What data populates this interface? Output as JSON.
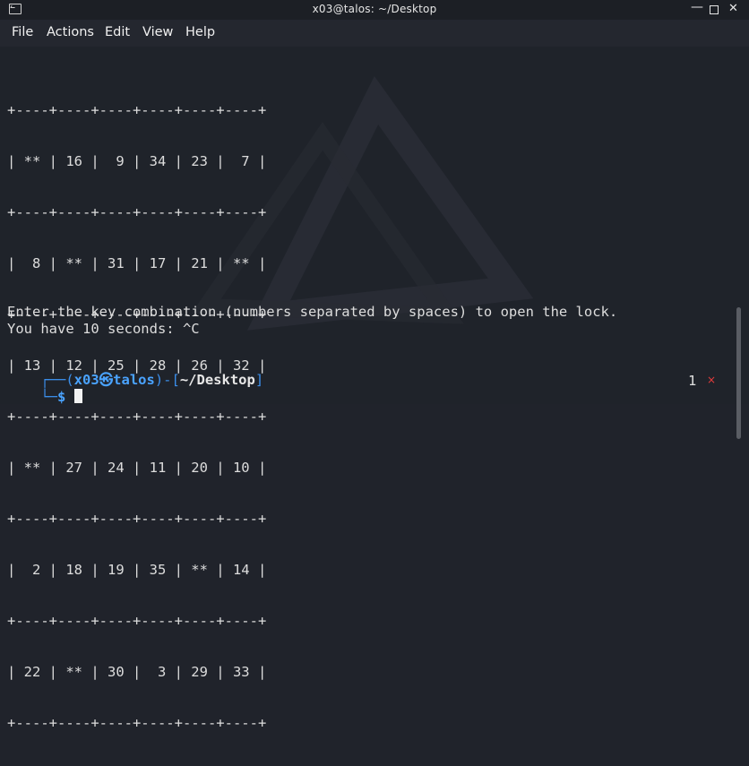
{
  "window": {
    "title": "x03@talos: ~/Desktop",
    "controls": {
      "minimize": "—",
      "close": "✕"
    }
  },
  "menu": [
    "File",
    "Actions",
    "Edit",
    "View",
    "Help"
  ],
  "terminal": {
    "grid_rows": [
      "+----+----+----+----+----+----+",
      "| ** | 16 |  9 | 34 | 23 |  7 |",
      "+----+----+----+----+----+----+",
      "|  8 | ** | 31 | 17 | 21 | ** |",
      "+----+----+----+----+----+----+",
      "| 13 | 12 | 25 | 28 | 26 | 32 |",
      "+----+----+----+----+----+----+",
      "| ** | 27 | 24 | 11 | 20 | 10 |",
      "+----+----+----+----+----+----+",
      "|  2 | 18 | 19 | 35 | ** | 14 |",
      "+----+----+----+----+----+----+",
      "| 22 | ** | 30 |  3 | 29 | 33 |",
      "+----+----+----+----+----+----+"
    ],
    "message_line1": "Enter the key combination (numbers separated by spaces) to open the lock.",
    "message_line2": "You have 10 seconds: ^C",
    "prompt": {
      "corner_top": "┌──(",
      "user": "x03",
      "at_symbol": "㉿",
      "host": "talos",
      "sep": ")-[",
      "path": "~/Desktop",
      "close": "]",
      "corner_bottom": "└─",
      "dollar": "$"
    },
    "status_count": "1",
    "status_mark": "×"
  }
}
